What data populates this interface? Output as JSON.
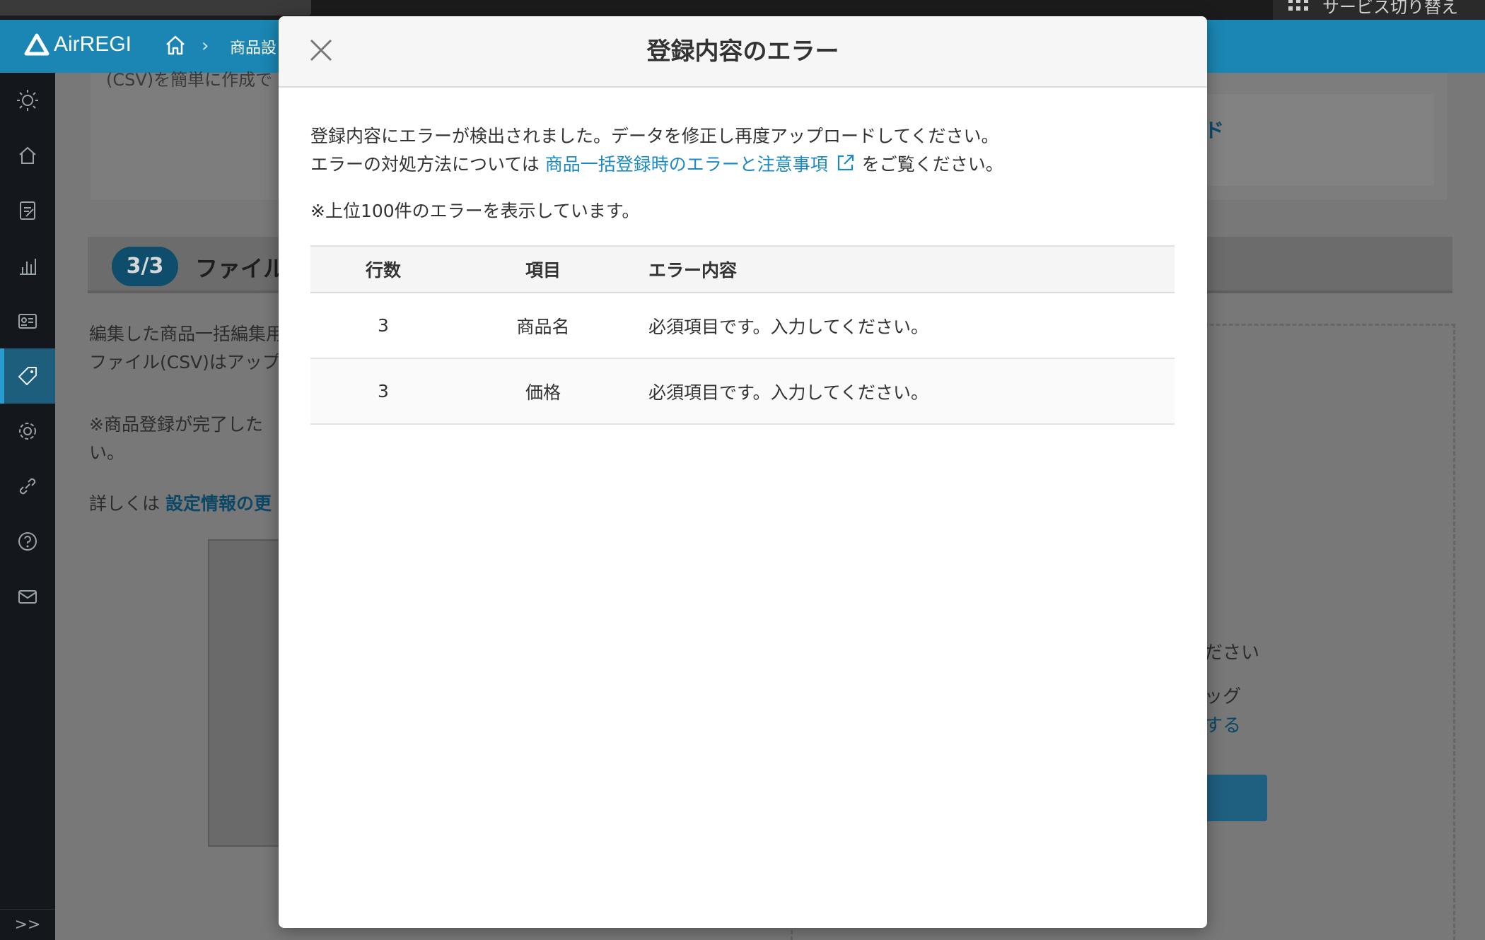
{
  "os_bar": {
    "service_switch_label": "サービス切り替え"
  },
  "header": {
    "logo_text": "AirREGI",
    "breadcrumb": "商品設"
  },
  "sidebar": {
    "items": [
      {
        "icon": "sun-icon"
      },
      {
        "icon": "home-icon"
      },
      {
        "icon": "document-icon"
      },
      {
        "icon": "chart-icon"
      },
      {
        "icon": "id-card-icon"
      },
      {
        "icon": "tag-icon",
        "active": true
      },
      {
        "icon": "gear-icon"
      },
      {
        "icon": "link-icon"
      },
      {
        "icon": "help-icon"
      },
      {
        "icon": "mail-icon"
      }
    ],
    "expand_label": ">>"
  },
  "background": {
    "csv_text": "(CSV)を簡単に作成で",
    "right_link": "ド",
    "step_badge": "3/3",
    "step_title": "ファイル",
    "text_line1": "編集した商品一括編集用",
    "text_line2": "ファイル(CSV)はアップ",
    "note_line1": "※商品登録が完了した",
    "note_line2": "い。",
    "detail_prefix": "詳しくは",
    "detail_link": "設定情報の更",
    "right_text1": "ださい",
    "right_text2": "ッグ",
    "right_link2": "する"
  },
  "modal": {
    "title": "登録内容のエラー",
    "message_line1": "登録内容にエラーが検出されました。データを修正し再度アップロードしてください。",
    "message_line2_prefix": "エラーの対処方法については",
    "message_link": "商品一括登録時のエラーと注意事項",
    "message_line2_suffix": "をご覧ください。",
    "note": "※上位100件のエラーを表示しています。",
    "table": {
      "headers": [
        "行数",
        "項目",
        "エラー内容"
      ],
      "rows": [
        [
          "3",
          "商品名",
          "必須項目です。入力してください。"
        ],
        [
          "3",
          "価格",
          "必須項目です。入力してください。"
        ]
      ]
    }
  }
}
